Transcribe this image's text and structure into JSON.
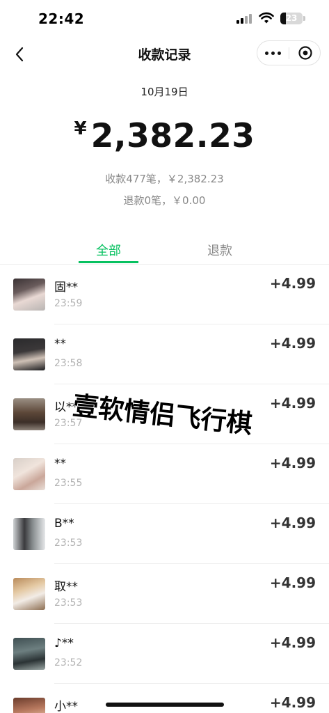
{
  "status_bar": {
    "time": "22:42",
    "battery_level": "23"
  },
  "nav": {
    "title": "收款记录"
  },
  "summary": {
    "date": "10月19日",
    "currency": "¥",
    "total_amount": "2,382.23",
    "received_line": "收款477笔，￥2,382.23",
    "refund_line": "退款0笔，￥0.00"
  },
  "tabs": [
    {
      "label": "全部",
      "active": true
    },
    {
      "label": "退款",
      "active": false
    }
  ],
  "colors": {
    "accent": "#07c160",
    "muted_text": "#888888"
  },
  "transactions": [
    {
      "name": "固**",
      "time": "23:59",
      "amount": "+4.99"
    },
    {
      "name": "**",
      "time": "23:58",
      "amount": "+4.99"
    },
    {
      "name": "以**",
      "time": "23:57",
      "amount": "+4.99"
    },
    {
      "name": "**",
      "time": "23:55",
      "amount": "+4.99"
    },
    {
      "name": "B**",
      "time": "23:53",
      "amount": "+4.99"
    },
    {
      "name": "取**",
      "time": "23:53",
      "amount": "+4.99"
    },
    {
      "name": "♪**",
      "time": "23:52",
      "amount": "+4.99"
    },
    {
      "name": "小**",
      "time": "",
      "amount": "+4.99"
    }
  ],
  "overlay_text": "壹软情侣飞行棋"
}
